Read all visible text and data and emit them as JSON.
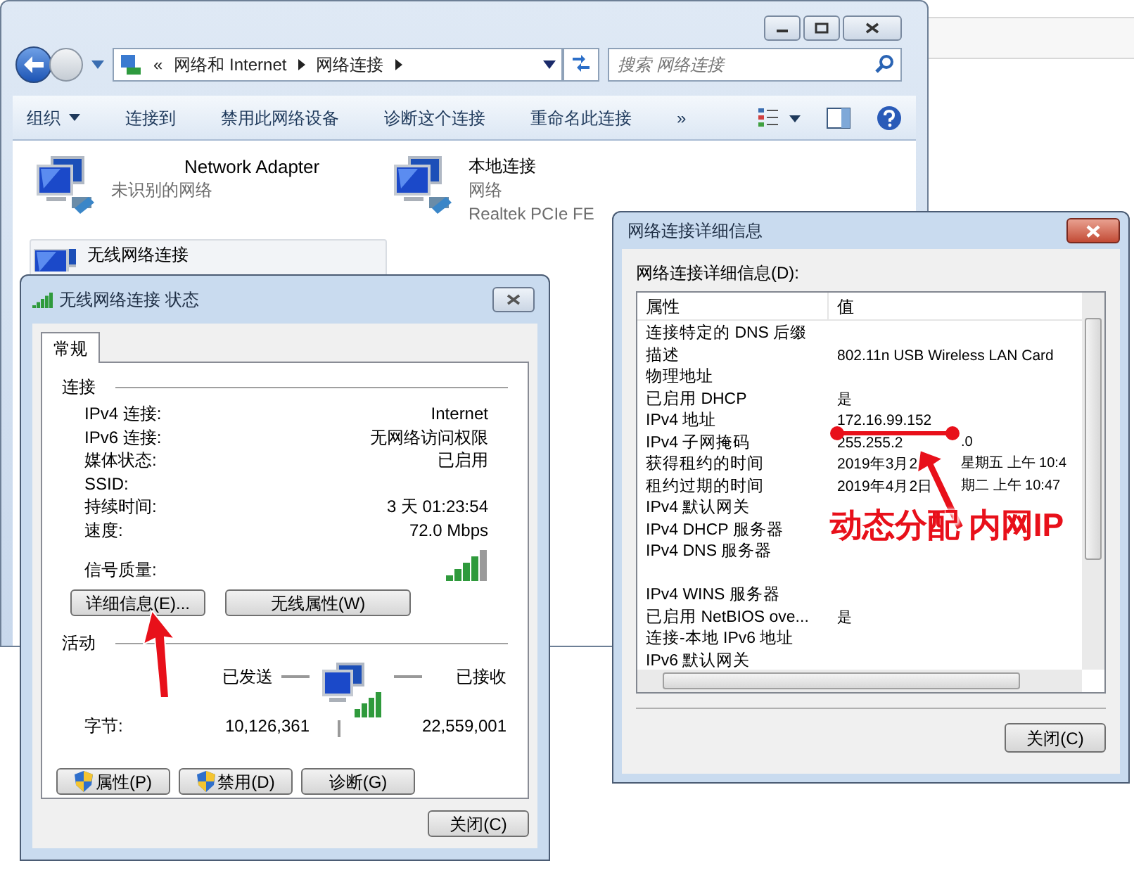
{
  "explorer": {
    "breadcrumb": [
      "«",
      "网络和 Internet",
      "网络连接"
    ],
    "search_placeholder": "搜索 网络连接",
    "toolbar": [
      {
        "label": "组织",
        "kind": "menu"
      },
      {
        "label": "连接到",
        "kind": "command"
      },
      {
        "label": "禁用此网络设备",
        "kind": "command"
      },
      {
        "label": "诊断这个连接",
        "kind": "command"
      },
      {
        "label": "重命名此连接",
        "kind": "command"
      },
      {
        "label": "»",
        "kind": "command"
      }
    ],
    "adapters": [
      {
        "name": "Network Adapter",
        "status": "未识别的网络",
        "selected": false
      },
      {
        "name": "本地连接",
        "status": "网络",
        "device": "Realtek PCIe FE",
        "selected": false
      },
      {
        "name": "无线网络连接",
        "selected": true
      }
    ]
  },
  "status_dialog": {
    "title": "无线网络连接 状态",
    "tabs": [
      {
        "label": "常规",
        "selected": true
      }
    ],
    "connection_heading": "连接",
    "rows": [
      {
        "label": "IPv4 连接:",
        "value": "Internet"
      },
      {
        "label": "IPv6 连接:",
        "value": "无网络访问权限"
      },
      {
        "label": "媒体状态:",
        "value": "已启用"
      },
      {
        "label": "SSID:"
      },
      {
        "label": "持续时间:",
        "value": "3 天 01:23:54"
      },
      {
        "label": "速度:",
        "value": "72.0 Mbps"
      }
    ],
    "signal_label": "信号质量:",
    "buttons": [
      "详细信息(E)...",
      "无线属性(W)"
    ],
    "activity_heading": "活动",
    "sent_label": "已发送",
    "received_label": "已接收",
    "bytes_label": "字节:",
    "bytes_sent": "10,126,361",
    "bytes_received": "22,559,001",
    "action_buttons": [
      {
        "label": "属性(P)",
        "shield": true
      },
      {
        "label": "禁用(D)",
        "shield": true
      },
      {
        "label": "诊断(G)",
        "shield": false
      }
    ],
    "close": "关闭(C)"
  },
  "details_dialog": {
    "title": "网络连接详细信息",
    "list_label": "网络连接详细信息(D):",
    "columns": [
      "属性",
      "值"
    ],
    "rows": [
      {
        "property": "连接特定的 DNS 后缀"
      },
      {
        "property": "描述",
        "value": "802.11n USB Wireless LAN Card"
      },
      {
        "property": "物理地址"
      },
      {
        "property": "已启用 DHCP",
        "value": "是"
      },
      {
        "property": "IPv4 地址",
        "value": "172.16.99.152"
      },
      {
        "property": "IPv4 子网掩码",
        "value": "255.255.2",
        "value_after": ".0"
      },
      {
        "property": "获得租约的时间",
        "value": "2019年3月2",
        "value_after": "星期五 上午 10:4"
      },
      {
        "property": "租约过期的时间",
        "value": "2019年4月2日",
        "value_after": "期二 上午 10:47"
      },
      {
        "property": "IPv4 默认网关"
      },
      {
        "property": "IPv4 DHCP 服务器"
      },
      {
        "property": "IPv4 DNS 服务器"
      },
      {
        "property": "IPv4 WINS 服务器",
        "gap_before": true
      },
      {
        "property": "已启用 NetBIOS ove...",
        "value": "是"
      },
      {
        "property": "连接-本地 IPv6 地址"
      },
      {
        "property": "IPv6 默认网关"
      }
    ],
    "close": "关闭(C)"
  },
  "annotation": {
    "label": "动态分配 内网IP"
  }
}
